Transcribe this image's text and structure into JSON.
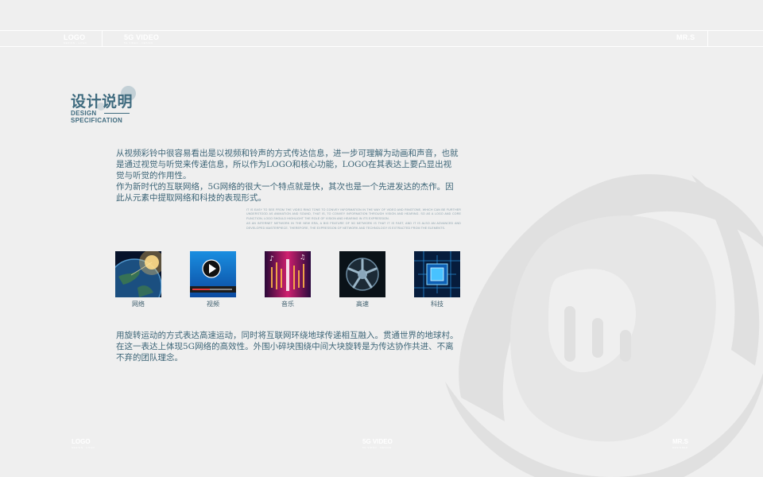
{
  "header": {
    "logo_label": "LOGO",
    "logo_sub": "DESIGN · LOGO",
    "video_label": "5G VIDEO",
    "video_sub": "5G VIDEO · DESIGN",
    "author_label": "MR.S"
  },
  "section": {
    "title_cn": "设计说明",
    "title_en_line1": "DESIGN",
    "title_en_line2": "SPECIFICATION"
  },
  "intro": {
    "line1": "从视频彩铃中很容易看出是以视频和铃声的方式传达信息，进一步可理解为动画和声音，也就",
    "line2": "是通过视觉与听觉来传递信息，所以作为LOGO和核心功能，LOGO在其表达上要凸显出视",
    "line3": "觉与听觉的作用性。",
    "line4": "作为新时代的互联网络，5G网络的很大一个特点就是快，其次也是一个先进发达的杰作。因",
    "line5": "此从元素中提取网络和科技的表现形式。"
  },
  "english_note": {
    "para1": "It is easy to see from the video ring tone to convey information in the way of video and ringtone, which can be further understood as animation and sound, that is, to convey information through vision and hearing. So as a logo and core function, logo should highlight the role of vision and hearing in its expression.",
    "para2": "As an internet network in the new era, a big feature of 5G network is that it is fast, and it is also an advanced and developed masterpiece. Therefore, the expression of network and technology is extracted from the elements."
  },
  "thumbnails": [
    {
      "caption": "网络",
      "icon": "earth-network-image"
    },
    {
      "caption": "视频",
      "icon": "video-player-image"
    },
    {
      "caption": "音乐",
      "icon": "music-notes-image"
    },
    {
      "caption": "高速",
      "icon": "wheel-speed-image"
    },
    {
      "caption": "科技",
      "icon": "chip-tech-image"
    }
  ],
  "closing": {
    "line1": "用旋转运动的方式表达高速运动，同时将互联网环绕地球传递相互融入。贯通世界的地球村。",
    "line2": "在这一表达上体现5G网络的高效性。外围小碎块围绕中间大块旋转是为传达协作共进、不离",
    "line3": "不弃的团队理念。"
  },
  "footer": {
    "logo_label": "LOGO",
    "logo_sub": "DESIGN · LOGO",
    "video_label": "5G VIDEO",
    "video_sub": "5G VIDEO · DESIGN",
    "author_label": "MR.S",
    "author_sub": "DESIGNER"
  },
  "colors": {
    "background": "#efefef",
    "accent": "#3f6b7f",
    "watermark": "#e1e1e1"
  }
}
